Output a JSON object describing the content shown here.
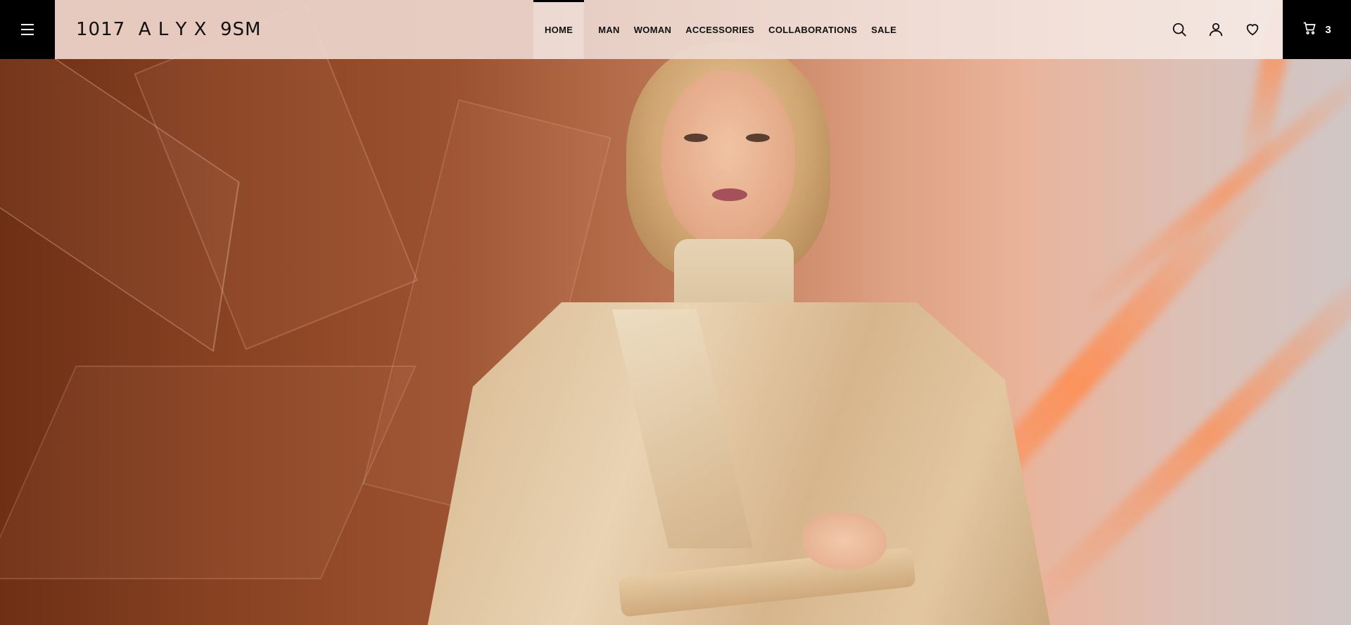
{
  "brand": {
    "logo_text": "1017  A L Y X  9SM"
  },
  "header": {
    "menu_icon": "hamburger-menu-icon",
    "nav": [
      {
        "label": "HOME",
        "active": true
      },
      {
        "label": "MAN",
        "active": false
      },
      {
        "label": "WOMAN",
        "active": false
      },
      {
        "label": "ACCESSORIES",
        "active": false
      },
      {
        "label": "COLLABORATIONS",
        "active": false
      },
      {
        "label": "SALE",
        "active": false
      }
    ],
    "icons": [
      "search-icon",
      "account-icon",
      "wishlist-heart-icon"
    ],
    "cart": {
      "icon": "cart-icon",
      "count": "3"
    }
  },
  "colors": {
    "header_dark": "#000000",
    "header_light": "#efdcd4",
    "hero_warm": "#8a4423",
    "hero_peach": "#e9b49b",
    "hero_grey": "#d0c6c5",
    "accent_orange": "#ff8c50"
  }
}
